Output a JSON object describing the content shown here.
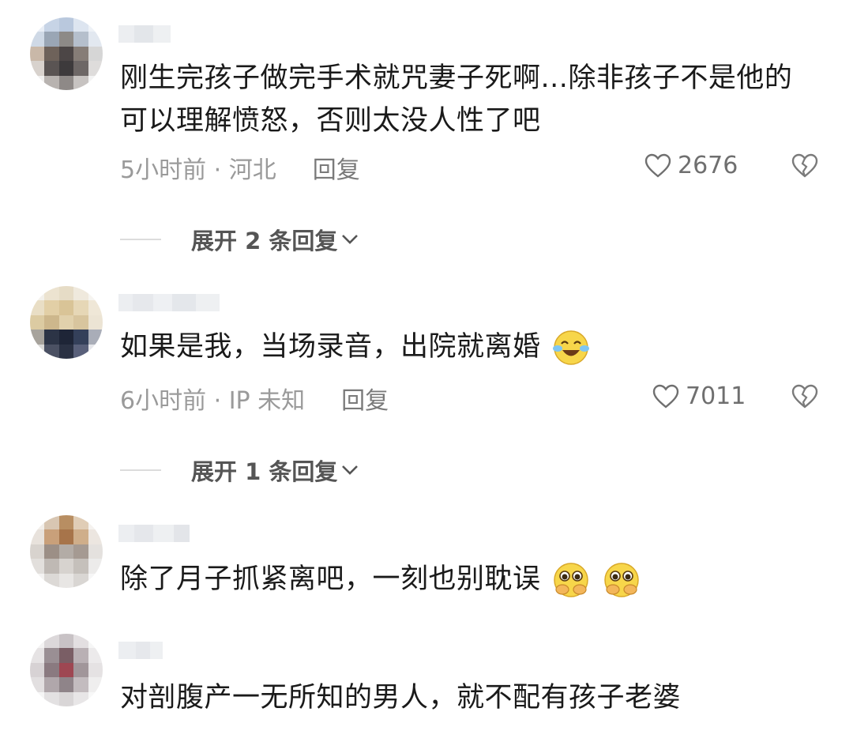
{
  "comments": [
    {
      "text": "刚生完孩子做完手术就咒妻子死啊...除非孩子不是他的可以理解愤怒，否则太没人性了吧",
      "time_location": "5小时前 · 河北",
      "reply_label": "回复",
      "likes": "2676",
      "expand_label": "展开 2 条回复"
    },
    {
      "text": "如果是我，当场录音，出院就离婚",
      "time_location": "6小时前 · IP 未知",
      "reply_label": "回复",
      "likes": "7011",
      "expand_label": "展开 1 条回复"
    },
    {
      "text": "除了月子抓紧离吧，一刻也别耽误"
    },
    {
      "text": "对剖腹产一无所知的男人，就不配有孩子老婆"
    }
  ],
  "icons": {
    "like": "heart-outline-icon",
    "dislike": "broken-heart-icon",
    "expand": "chevron-down-icon",
    "emoji_cry": "crying-laughing-emoji",
    "emoji_pleading": "pleading-hands-emoji"
  },
  "colors": {
    "text": "#1a1a1a",
    "meta": "#9a9a9a",
    "background": "#ffffff"
  }
}
